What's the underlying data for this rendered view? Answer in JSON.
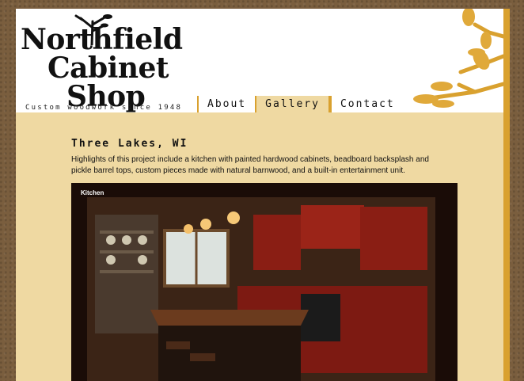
{
  "logo": {
    "line1": "Northfield",
    "line2": "Cabinet",
    "line3": "Shop",
    "tagline": "Custom woodwork since 1948",
    "tree_icon": "tree-icon"
  },
  "nav": {
    "items": [
      {
        "label": "About",
        "active": false
      },
      {
        "label": "Gallery",
        "active": true
      },
      {
        "label": "Contact",
        "active": false
      }
    ]
  },
  "project": {
    "title": "Three Lakes, WI",
    "description": "Highlights of this project include a kitchen with painted hardwood cabinets, beadboard backsplash and pickle barrel tops, custom pieces made with natural barnwood, and a built-in entertainment unit."
  },
  "photo": {
    "caption": "Kitchen"
  },
  "colors": {
    "page_background": "#efd9a2",
    "accent": "#d9a12f",
    "header_background": "#ffffff",
    "outer_background": "#7a5e3e"
  }
}
